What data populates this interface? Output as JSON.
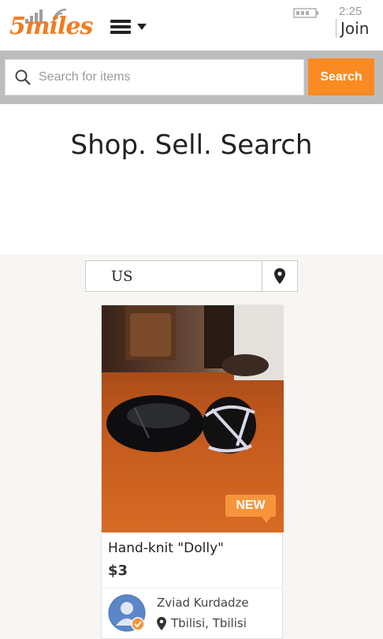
{
  "header": {
    "logo_text": "5miles",
    "clock": "2:25",
    "join_label": "Join"
  },
  "search": {
    "placeholder": "Search for items",
    "button_label": "Search"
  },
  "hero": {
    "title": "Shop. Sell. Search"
  },
  "location": {
    "value": "US"
  },
  "listing": {
    "badge": "NEW",
    "title": "Hand-knit \"Dolly\"",
    "price": "$3",
    "seller_name": "Zviad Kurdadze",
    "seller_location": "Tbilisi, Tbilisi"
  },
  "colors": {
    "brand_orange": "#f27b21",
    "search_button": "#fa8a22",
    "badge": "#f7953d"
  }
}
